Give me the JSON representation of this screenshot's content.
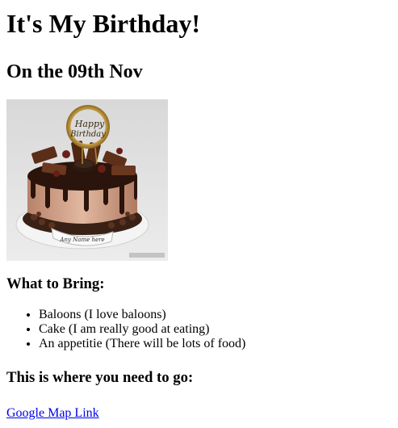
{
  "page": {
    "title": "It's My Birthday!",
    "subtitle": "On the 09th Nov"
  },
  "image": {
    "topper_line1": "Happy",
    "topper_line2": "Birthday",
    "plaque": "Any Name here"
  },
  "bring": {
    "heading": "What to Bring:",
    "items": [
      "Baloons (I love baloons)",
      "Cake (I am really good at eating)",
      "An appetitie (There will be lots of food)"
    ]
  },
  "location": {
    "heading": "This is where you need to go:",
    "link_text": "Google Map Link"
  },
  "colors": {
    "link": "#0000ee"
  }
}
